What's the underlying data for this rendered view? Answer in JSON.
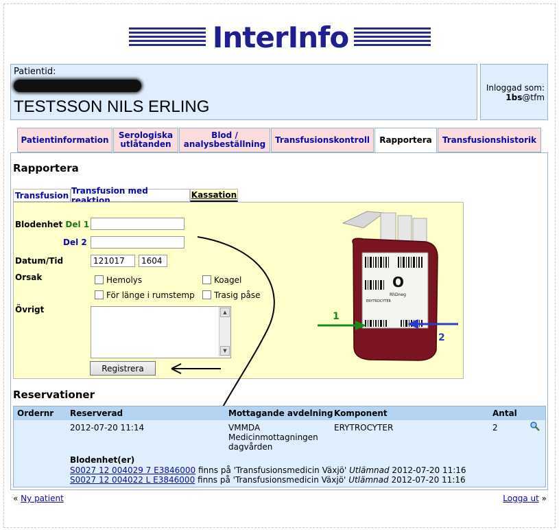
{
  "app": {
    "logo_text": "InterInfo"
  },
  "patient": {
    "label": "Patientid:",
    "name": "TESTSSON NILS ERLING"
  },
  "login": {
    "label": "Inloggad som:",
    "user": "1bs",
    "domain": "@tfm"
  },
  "tabs": [
    {
      "label": "Patientinformation",
      "active": false
    },
    {
      "label": "Serologiska utlåtanden",
      "active": false
    },
    {
      "label": "Blod / analysbeställning",
      "active": false
    },
    {
      "label": "Transfusionskontroll",
      "active": false
    },
    {
      "label": "Rapportera",
      "active": true
    },
    {
      "label": "Transfusionshistorik",
      "active": false
    }
  ],
  "page_title": "Rapportera",
  "subtabs": [
    {
      "label": "Transfusion",
      "active": false
    },
    {
      "label": "Transfusion med reaktion",
      "active": false
    },
    {
      "label": "Kassation",
      "active": true
    }
  ],
  "form": {
    "blodenhet_label": "Blodenhet",
    "del1_label": "Del 1",
    "del2_label": "Del 2",
    "del1_value": "",
    "del2_value": "",
    "datum_label": "Datum/Tid",
    "date_value": "121017",
    "time_value": "1604",
    "orsak_label": "Orsak",
    "reasons": [
      "Hemolys",
      "Koagel",
      "För länge i rumstemp",
      "Trasig påse"
    ],
    "ovrigt_label": "Övrigt",
    "submit_label": "Registrera"
  },
  "bag_image": {
    "marker1": "1",
    "marker2": "2",
    "bloodgroup": "O",
    "rh": "RhDneg",
    "product": "ERYTROCYTER",
    "colors": {
      "green_arrow": "#1a8a1a",
      "blue_arrow": "#2a3acc",
      "blood": "#7a1420"
    }
  },
  "reservations": {
    "title": "Reservationer",
    "headers": [
      "Ordernr",
      "Reserverad",
      "Mottagande avdelning",
      "Komponent",
      "Antal"
    ],
    "row": {
      "ordernr": "",
      "reserverad": "2012-07-20 11:14",
      "avdelning_code": "VMMDA",
      "avdelning_name": "Medicinmottagningen dagvården",
      "komponent": "ERYTROCYTER",
      "antal": "2"
    },
    "units_label": "Blodenhet(er)",
    "units": [
      {
        "id": "S0027 12 004029 7 E3846000",
        "location": "finns på 'Transfusionsmedicin Växjö'",
        "status": "Utlämnad",
        "time": "2012-07-20 11:16"
      },
      {
        "id": "S0027 12 004022 L E3846000",
        "location": "finns på 'Transfusionsmedicin Växjö'",
        "status": "Utlämnad",
        "time": "2012-07-20 11:16"
      }
    ]
  },
  "footer": {
    "left_prefix": "«",
    "left_link": "Ny patient",
    "right_link": "Logga ut",
    "right_suffix": "»"
  },
  "colors": {
    "tab_bg": "#fbdcdc",
    "panel_bg": "#dfeefc",
    "form_bg": "#ffffcc",
    "link": "#0a0aa8"
  }
}
